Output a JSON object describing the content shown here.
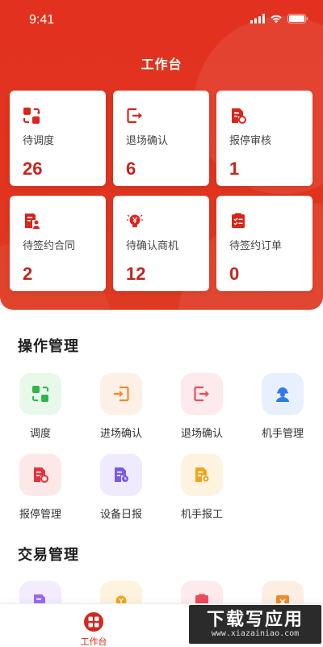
{
  "status_bar": {
    "time": "9:41"
  },
  "header": {
    "title": "工作台"
  },
  "stats": [
    {
      "icon": "swap-icon",
      "label": "待调度",
      "value": "26"
    },
    {
      "icon": "exit-icon",
      "label": "退场确认",
      "value": "6"
    },
    {
      "icon": "document-review-icon",
      "label": "报停审核",
      "value": "1"
    },
    {
      "icon": "contract-user-icon",
      "label": "待签约合同",
      "value": "2"
    },
    {
      "icon": "lightbulb-yen-icon",
      "label": "待确认商机",
      "value": "12"
    },
    {
      "icon": "checklist-icon",
      "label": "待签约订单",
      "value": "0"
    }
  ],
  "operations": {
    "title": "操作管理",
    "items": [
      {
        "icon": "swap-icon",
        "label": "调度"
      },
      {
        "icon": "enter-icon",
        "label": "进场确认"
      },
      {
        "icon": "exit-icon",
        "label": "退场确认"
      },
      {
        "icon": "worker-icon",
        "label": "机手管理"
      },
      {
        "icon": "document-stop-icon",
        "label": "报停管理"
      },
      {
        "icon": "document-clock-icon",
        "label": "设备日报"
      },
      {
        "icon": "document-gear-icon",
        "label": "机手报工"
      }
    ]
  },
  "trade": {
    "title": "交易管理"
  },
  "tabbar": {
    "home_label": "工作台"
  },
  "watermark": {
    "main": "下载写应用",
    "sub": "www.xiazainiao.com"
  },
  "colors": {
    "primary": "#d7261d",
    "header": "#e2321f",
    "value_text": "#c4261a"
  }
}
